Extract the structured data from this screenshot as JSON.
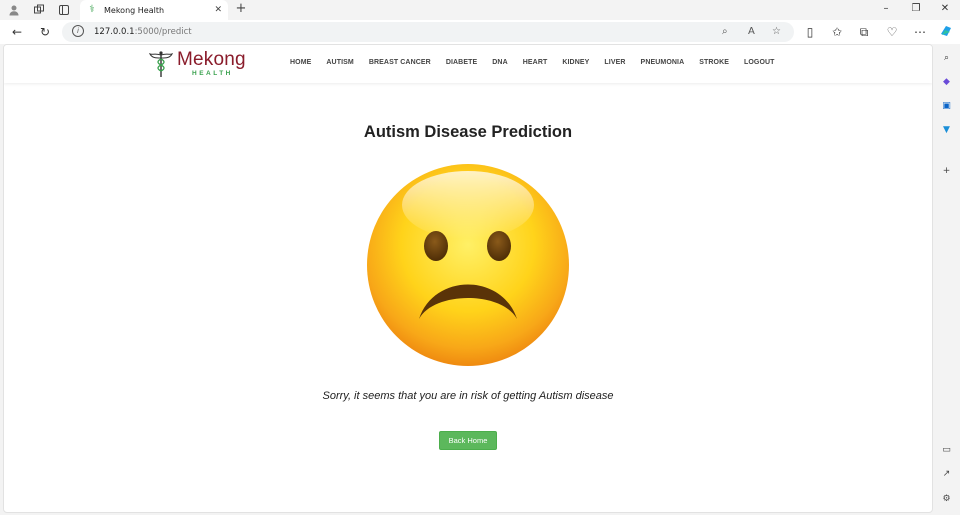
{
  "browser": {
    "tab_title": "Mekong Health",
    "url_host": "127.0.0.1",
    "url_rest": ":5000/predict",
    "accent": "#0a64c8"
  },
  "site": {
    "brand": "Mekong",
    "brand_sub": "HEALTH",
    "brand_color": "#8a1c2b",
    "sub_color": "#3aa14e",
    "menu": [
      "HOME",
      "AUTISM",
      "BREAST CANCER",
      "DIABETE",
      "DNA",
      "HEART",
      "KIDNEY",
      "LIVER",
      "PNEUMONIA",
      "STROKE",
      "LOGOUT"
    ]
  },
  "main": {
    "heading": "Autism Disease Prediction",
    "result_icon": "sad-face-emoji",
    "message": "Sorry, it seems that you are in risk of getting Autism disease",
    "back_button": "Back Home",
    "button_color": "#5cb85c"
  }
}
